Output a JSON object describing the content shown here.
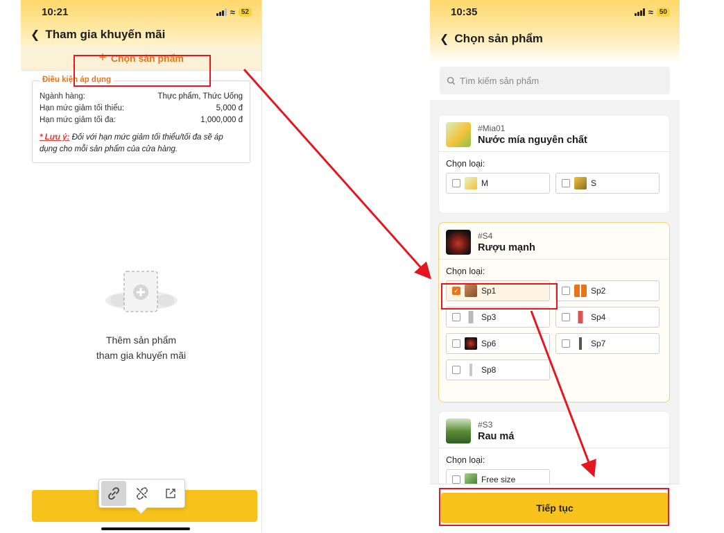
{
  "left": {
    "status_time": "10:21",
    "battery": "52",
    "nav_title": "Tham gia khuyến mãi",
    "choose_product_label": "Chọn sản phẩm",
    "conditions": {
      "title": "Điều kiện áp dụng",
      "rows": [
        {
          "label": "Ngành hàng:",
          "value": "Thực phẩm, Thức Uống"
        },
        {
          "label": "Hạn mức giảm tối thiểu:",
          "value": "5,000 đ"
        },
        {
          "label": "Hạn mức giảm tối đa:",
          "value": "1,000,000 đ"
        }
      ],
      "note_label": "* Lưu ý:",
      "note_text": "Đối với hạn mức giảm tối thiểu/tối đa sẽ áp dụng cho mỗi sản phẩm của cửa hàng."
    },
    "empty_line1": "Thêm sản phẩm",
    "empty_line2": "tham gia khuyến mãi",
    "popover_icons": [
      "link-icon",
      "unlink-icon",
      "open-external-icon"
    ]
  },
  "right": {
    "status_time": "10:35",
    "battery": "50",
    "nav_title": "Chọn sản phẩm",
    "search_placeholder": "Tìm kiếm sản phẩm",
    "variant_label": "Chọn loại:",
    "products": [
      {
        "code": "#Mia01",
        "name": "Nước mía nguyên chất",
        "variants": [
          {
            "name": "M",
            "checked": false
          },
          {
            "name": "S",
            "checked": false
          }
        ]
      },
      {
        "code": "#S4",
        "name": "Rượu mạnh",
        "variants": [
          {
            "name": "Sp1",
            "checked": true
          },
          {
            "name": "Sp2",
            "checked": false
          },
          {
            "name": "Sp3",
            "checked": false
          },
          {
            "name": "Sp4",
            "checked": false
          },
          {
            "name": "Sp6",
            "checked": false
          },
          {
            "name": "Sp7",
            "checked": false
          },
          {
            "name": "Sp8",
            "checked": false
          }
        ]
      },
      {
        "code": "#S3",
        "name": "Rau má",
        "variants": [
          {
            "name": "Free size",
            "checked": false
          }
        ]
      }
    ],
    "continue_label": "Tiếp tục"
  },
  "colors": {
    "accent_orange": "#e8751a",
    "button_yellow": "#f7c21b",
    "annotation_red": "#e5161d"
  }
}
